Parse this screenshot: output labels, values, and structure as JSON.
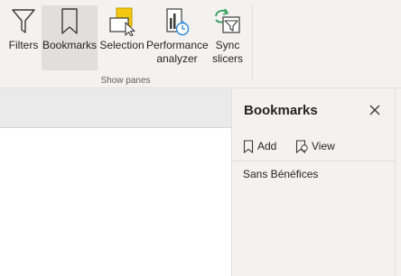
{
  "ribbon": {
    "buttons": [
      {
        "label": "Filters",
        "icon": "filter-icon"
      },
      {
        "label": "Bookmarks",
        "icon": "bookmark-icon"
      },
      {
        "label": "Selection",
        "icon": "selection-icon"
      },
      {
        "label_line1": "Performance",
        "label_line2": "analyzer",
        "icon": "performance-analyzer-icon"
      },
      {
        "label_line1": "Sync",
        "label_line2": "slicers",
        "icon": "sync-slicers-icon"
      }
    ],
    "group_label": "Show panes"
  },
  "pane": {
    "title": "Bookmarks",
    "add_label": "Add",
    "view_label": "View",
    "items": [
      {
        "label": "Sans Bénéfices"
      }
    ]
  },
  "colors": {
    "accent_gold": "#f2c811",
    "accent_green": "#2e9e5b",
    "accent_blue": "#2b88d8",
    "ribbon_bg": "#f3f2f1"
  }
}
